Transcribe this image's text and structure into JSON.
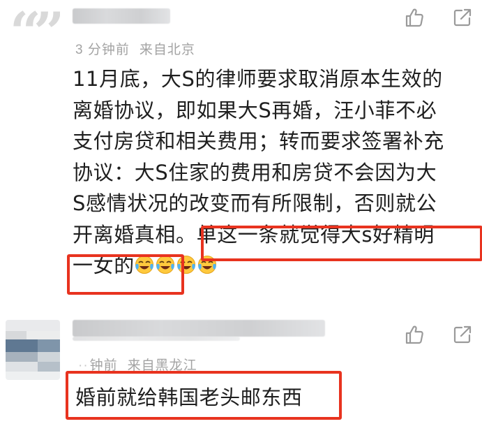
{
  "comments": [
    {
      "time": "3 分钟前",
      "location": "来自北京",
      "text_lines": [
        "11月底，大S的律师要求取消原本生效的",
        "离婚协议，即如果大S再婚，汪小菲不必",
        "支付房贷和相关费用；转而要求签署补充",
        "协议：大S住家的费用和房贷不会因为大",
        "S感情状况的改变而有所限制，否则就公",
        "开离婚真相。单这一条就觉得大s好精明"
      ],
      "last_line_text": "一女的",
      "emoji": [
        "crying-laughing-face-icon",
        "crying-laughing-face-icon",
        "crying-laughing-face-icon",
        "crying-laughing-face-icon"
      ],
      "actions": [
        "thumbs-up-icon",
        "share-icon"
      ]
    },
    {
      "time": "钟前",
      "location": "来自黑龙江",
      "text": "婚前就给韩国老头邮东西",
      "actions": [
        "thumbs-up-icon",
        "share-icon"
      ]
    }
  ],
  "colors": {
    "highlight_border": "#e8331f",
    "meta_text": "#a3a3a3",
    "body_text": "#1f1f1f"
  }
}
